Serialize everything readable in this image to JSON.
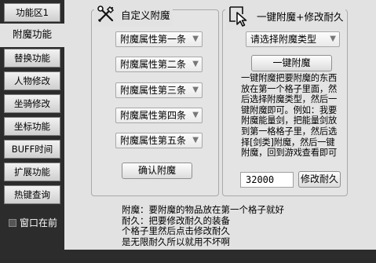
{
  "sidebar": {
    "items": [
      {
        "label": "功能区1",
        "active": false
      },
      {
        "label": "附魔功能",
        "active": true
      },
      {
        "label": "替换功能",
        "active": false
      },
      {
        "label": "人物修改",
        "active": false
      },
      {
        "label": "坐骑修改",
        "active": false
      },
      {
        "label": "坐标功能",
        "active": false
      },
      {
        "label": "BUFF时间",
        "active": false
      },
      {
        "label": "扩展功能",
        "active": false
      },
      {
        "label": "热键查询",
        "active": false
      }
    ],
    "front_option": {
      "label": "窗口在前",
      "checked": false
    }
  },
  "custom_enchant": {
    "title": "自定义附魔",
    "icon": "crossed-tools-icon",
    "attributes": [
      {
        "value": "附魔属性第一条"
      },
      {
        "value": "附魔属性第二条"
      },
      {
        "value": "附魔属性第三条"
      },
      {
        "value": "附魔属性第四条"
      },
      {
        "value": "附魔属性第五条"
      }
    ],
    "confirm_label": "确认附魔"
  },
  "quick_enchant": {
    "title": "一键附魔+修改耐久",
    "icon": "cursor-pointer-icon",
    "type_select": "请选择附魔类型",
    "enchant_label": "一键附魔",
    "description_lines": [
      "一键附魔把要附魔的东西",
      "放在第一个格子里面，然",
      "后选择附魔类型，然后一",
      "键附魔即可。例如：我要",
      "附魔能量剑，把能量剑放",
      "到第一格格子里，然后选",
      "择[剑类]附魔，然后一键",
      "附魔，回到游戏查看即可"
    ],
    "durability_value": "32000",
    "durability_label": "修改耐久"
  },
  "notes": [
    "附魔：要附魔的物品放在第一个格子就好",
    "耐久：把要修改耐久的装备",
    "个格子里然后点击修改耐久",
    "是无限耐久所以就用不坏啊"
  ],
  "colors": {
    "sidebar_bg": "#2c2c2c",
    "window_bg": "#e2e2e2"
  }
}
